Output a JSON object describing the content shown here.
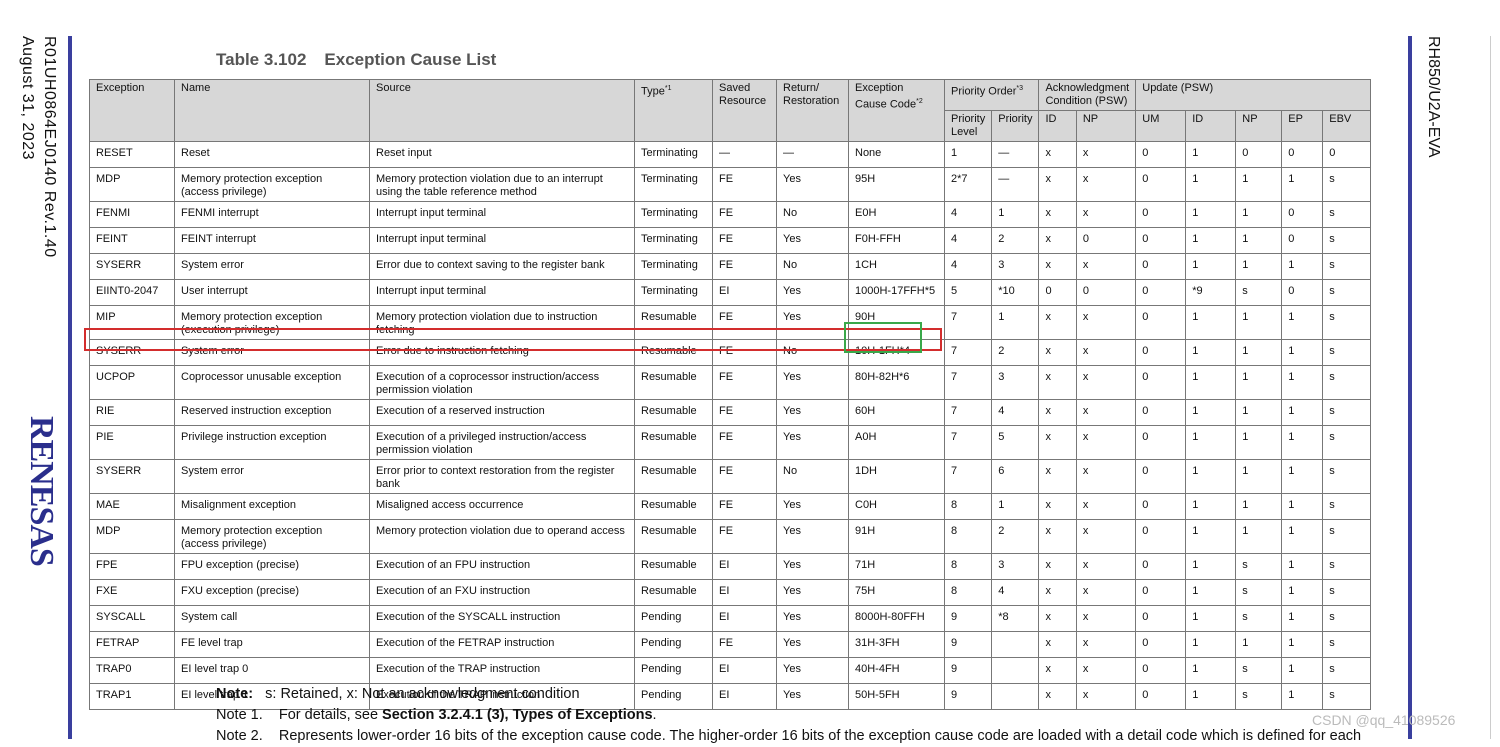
{
  "side": {
    "doc_id": "R01UH0864EJ0140  Rev.1.40",
    "date": "August 31, 2023",
    "logo": "RENESAS",
    "product": "RH850/U2A-EVA"
  },
  "title": {
    "label": "Table 3.102",
    "text": "Exception Cause List"
  },
  "header": {
    "exception": "Exception",
    "name": "Name",
    "source": "Source",
    "type": "Type",
    "type_sup": "*1",
    "saved": "Saved Resource",
    "return": "Return/ Restoration",
    "code": "Exception Cause Code",
    "code_sup": "*2",
    "priority": "Priority Order",
    "priority_sup": "*3",
    "ack": "Acknowledgment Condition (PSW)",
    "update": "Update (PSW)",
    "sub": [
      "Priority Level",
      "Priority",
      "ID",
      "NP",
      "UM",
      "ID",
      "NP",
      "EP",
      "EBV"
    ]
  },
  "rows": [
    [
      "RESET",
      "Reset",
      "Reset input",
      "Terminating",
      "—",
      "—",
      "None",
      "1",
      "—",
      "x",
      "x",
      "0",
      "1",
      "0",
      "0",
      "0"
    ],
    [
      "MDP",
      "Memory protection exception (access privilege)",
      "Memory protection violation due to an interrupt using the table reference method",
      "Terminating",
      "FE",
      "Yes",
      "95H",
      "2*7",
      "—",
      "x",
      "x",
      "0",
      "1",
      "1",
      "1",
      "s"
    ],
    [
      "FENMI",
      "FENMI interrupt",
      "Interrupt input terminal",
      "Terminating",
      "FE",
      "No",
      "E0H",
      "4",
      "1",
      "x",
      "x",
      "0",
      "1",
      "1",
      "0",
      "s"
    ],
    [
      "FEINT",
      "FEINT interrupt",
      "Interrupt input terminal",
      "Terminating",
      "FE",
      "Yes",
      "F0H-FFH",
      "4",
      "2",
      "x",
      "0",
      "0",
      "1",
      "1",
      "0",
      "s"
    ],
    [
      "SYSERR",
      "System error",
      "Error due to context saving to the register bank",
      "Terminating",
      "FE",
      "No",
      "1CH",
      "4",
      "3",
      "x",
      "x",
      "0",
      "1",
      "1",
      "1",
      "s"
    ],
    [
      "EIINT0-2047",
      "User interrupt",
      "Interrupt input terminal",
      "Terminating",
      "EI",
      "Yes",
      "1000H-17FFH*5",
      "5",
      "*10",
      "0",
      "0",
      "0",
      "*9",
      "s",
      "0",
      "s"
    ],
    [
      "MIP",
      "Memory protection exception (execution privilege)",
      "Memory protection violation due to instruction fetching",
      "Resumable",
      "FE",
      "Yes",
      "90H",
      "7",
      "1",
      "x",
      "x",
      "0",
      "1",
      "1",
      "1",
      "s"
    ],
    [
      "SYSERR",
      "System error",
      "Error due to instruction fetching",
      "Resumable",
      "FE",
      "No",
      "10H-1FH*4",
      "7",
      "2",
      "x",
      "x",
      "0",
      "1",
      "1",
      "1",
      "s"
    ],
    [
      "UCPOP",
      "Coprocessor unusable exception",
      "Execution of a coprocessor instruction/access permission violation",
      "Resumable",
      "FE",
      "Yes",
      "80H-82H*6",
      "7",
      "3",
      "x",
      "x",
      "0",
      "1",
      "1",
      "1",
      "s"
    ],
    [
      "RIE",
      "Reserved instruction exception",
      "Execution of a reserved instruction",
      "Resumable",
      "FE",
      "Yes",
      "60H",
      "7",
      "4",
      "x",
      "x",
      "0",
      "1",
      "1",
      "1",
      "s"
    ],
    [
      "PIE",
      "Privilege instruction exception",
      "Execution of a privileged instruction/access permission violation",
      "Resumable",
      "FE",
      "Yes",
      "A0H",
      "7",
      "5",
      "x",
      "x",
      "0",
      "1",
      "1",
      "1",
      "s"
    ],
    [
      "SYSERR",
      "System error",
      "Error prior to context restoration from the register bank",
      "Resumable",
      "FE",
      "No",
      "1DH",
      "7",
      "6",
      "x",
      "x",
      "0",
      "1",
      "1",
      "1",
      "s"
    ],
    [
      "MAE",
      "Misalignment exception",
      "Misaligned access occurrence",
      "Resumable",
      "FE",
      "Yes",
      "C0H",
      "8",
      "1",
      "x",
      "x",
      "0",
      "1",
      "1",
      "1",
      "s"
    ],
    [
      "MDP",
      "Memory protection exception (access privilege)",
      "Memory protection violation due to operand access",
      "Resumable",
      "FE",
      "Yes",
      "91H",
      "8",
      "2",
      "x",
      "x",
      "0",
      "1",
      "1",
      "1",
      "s"
    ],
    [
      "FPE",
      "FPU exception (precise)",
      "Execution of an FPU instruction",
      "Resumable",
      "EI",
      "Yes",
      "71H",
      "8",
      "3",
      "x",
      "x",
      "0",
      "1",
      "s",
      "1",
      "s"
    ],
    [
      "FXE",
      "FXU exception (precise)",
      "Execution of an FXU instruction",
      "Resumable",
      "EI",
      "Yes",
      "75H",
      "8",
      "4",
      "x",
      "x",
      "0",
      "1",
      "s",
      "1",
      "s"
    ],
    [
      "SYSCALL",
      "System call",
      "Execution of the SYSCALL instruction",
      "Pending",
      "EI",
      "Yes",
      "8000H-80FFH",
      "9",
      "*8",
      "x",
      "x",
      "0",
      "1",
      "s",
      "1",
      "s"
    ],
    [
      "FETRAP",
      "FE level trap",
      "Execution of the FETRAP instruction",
      "Pending",
      "FE",
      "Yes",
      "31H-3FH",
      "9",
      "",
      "x",
      "x",
      "0",
      "1",
      "1",
      "1",
      "s"
    ],
    [
      "TRAP0",
      "EI level trap 0",
      "Execution of the TRAP instruction",
      "Pending",
      "EI",
      "Yes",
      "40H-4FH",
      "9",
      "",
      "x",
      "x",
      "0",
      "1",
      "s",
      "1",
      "s"
    ],
    [
      "TRAP1",
      "EI level trap 1",
      "Execution of the TRAP instruction",
      "Pending",
      "EI",
      "Yes",
      "50H-5FH",
      "9",
      "",
      "x",
      "x",
      "0",
      "1",
      "s",
      "1",
      "s"
    ]
  ],
  "notes": {
    "note_label": "Note:",
    "note_text": "s: Retained, x: Not an acknowledgment condition",
    "note1_label": "Note 1.",
    "note1_pre": "For details, see ",
    "note1_bold": "Section 3.2.4.1 (3), Types of Exceptions",
    "note1_post": ".",
    "note2_label": "Note 2.",
    "note2_text": "Represents lower-order 16 bits of the exception cause code. The higher-order 16 bits of the exception cause code are loaded with a detail code which is defined for each"
  },
  "watermark": "CSDN @qq_41089526",
  "colors": {
    "rule": "#3a3f9e",
    "highlight_row": "#d32d2d",
    "highlight_code": "#3aa84a",
    "header_bg": "#d7d7d7"
  }
}
